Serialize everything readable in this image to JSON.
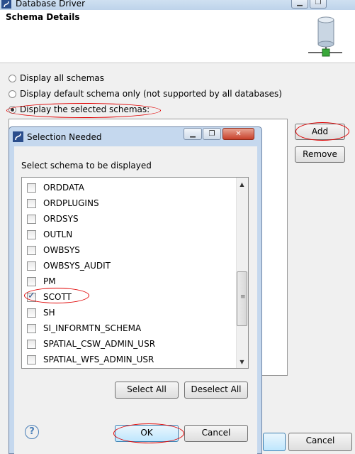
{
  "outer": {
    "title": "Database Driver",
    "minimize_glyph": "▁",
    "restore_glyph": "❐",
    "header_title": "Schema Details",
    "options": [
      {
        "label": "Display all schemas",
        "selected": false
      },
      {
        "label": "Display default schema only (not supported by all databases)",
        "selected": false
      },
      {
        "label": "Display the selected schemas:",
        "selected": true
      }
    ],
    "add_label": "Add",
    "remove_label": "Remove",
    "cancel_label": "Cancel"
  },
  "dialog": {
    "title": "Selection Needed",
    "minimize_glyph": "▁",
    "restore_glyph": "❐",
    "close_glyph": "✕",
    "prompt": "Select schema to be displayed",
    "schemas": [
      {
        "name": "ORDDATA",
        "checked": false
      },
      {
        "name": "ORDPLUGINS",
        "checked": false
      },
      {
        "name": "ORDSYS",
        "checked": false
      },
      {
        "name": "OUTLN",
        "checked": false
      },
      {
        "name": "OWBSYS",
        "checked": false
      },
      {
        "name": "OWBSYS_AUDIT",
        "checked": false
      },
      {
        "name": "PM",
        "checked": false
      },
      {
        "name": "SCOTT",
        "checked": true
      },
      {
        "name": "SH",
        "checked": false
      },
      {
        "name": "SI_INFORMTN_SCHEMA",
        "checked": false
      },
      {
        "name": "SPATIAL_CSW_ADMIN_USR",
        "checked": false
      },
      {
        "name": "SPATIAL_WFS_ADMIN_USR",
        "checked": false
      }
    ],
    "select_all_label": "Select All",
    "deselect_all_label": "Deselect All",
    "ok_label": "OK",
    "cancel_label": "Cancel",
    "help_glyph": "?"
  },
  "colors": {
    "annotation": "#e00000",
    "title_bar": "#c5d8ee"
  }
}
